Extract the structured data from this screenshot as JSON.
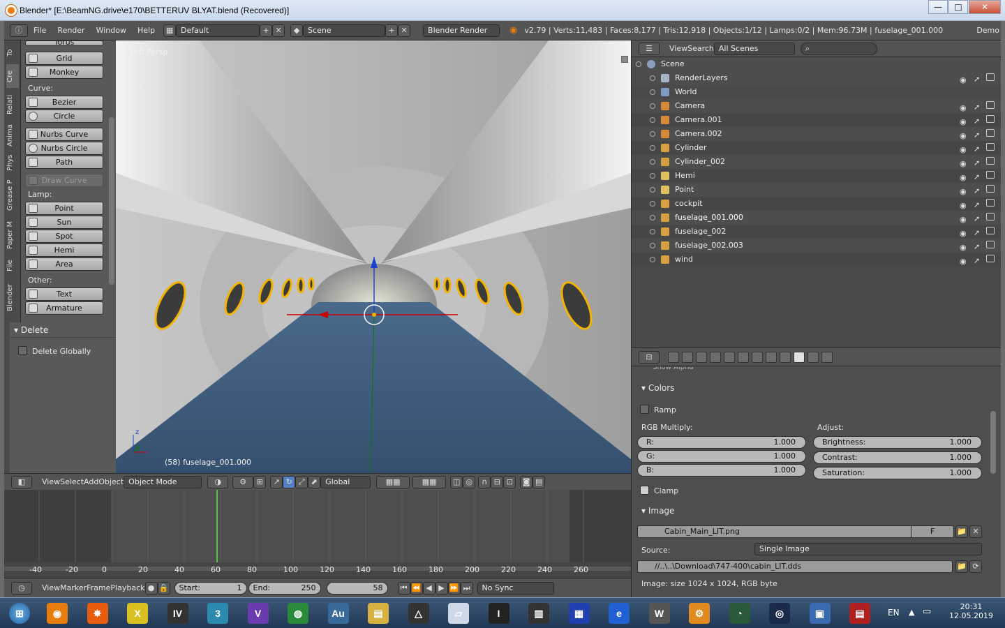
{
  "window": {
    "title": "Blender* [E:\\BeamNG.drive\\e170\\BETTERUV BLYAT.blend (Recovered)]",
    "btn_min": "—",
    "btn_max": "□",
    "btn_close": "✕"
  },
  "topbar": {
    "menus": [
      "File",
      "Render",
      "Window",
      "Help"
    ],
    "layout": "Default",
    "scene": "Scene",
    "engine": "Blender Render",
    "stats": "v2.79 | Verts:11,483 | Faces:8,177 | Tris:12,918 | Objects:1/12 | Lamps:0/2 | Mem:96.73M | fuselage_001.000",
    "demo": "Demo"
  },
  "lefttabs": [
    "To",
    "Cre",
    "Relati",
    "Anima",
    "Phys",
    "Grease P",
    "Paper M",
    "File",
    "Blender"
  ],
  "toolshelf": {
    "torus": "Torus",
    "grid": "Grid",
    "monkey": "Monkey",
    "curve_label": "Curve:",
    "bezier": "Bezier",
    "circle": "Circle",
    "nurbs_curve": "Nurbs Curve",
    "nurbs_circle": "Nurbs Circle",
    "path": "Path",
    "draw_curve": "Draw Curve",
    "lamp_label": "Lamp:",
    "point": "Point",
    "sun": "Sun",
    "spot": "Spot",
    "hemi": "Hemi",
    "area": "Area",
    "other_label": "Other:",
    "text": "Text",
    "armature": "Armature"
  },
  "delete_panel": {
    "title": "Delete",
    "option": "Delete Globally"
  },
  "viewport": {
    "label": "Left Persp",
    "object_info": "(58) fuselage_001.000",
    "axis_z": "z",
    "axis_y": "y"
  },
  "view_header": {
    "menus": [
      "View",
      "Select",
      "Add",
      "Object"
    ],
    "mode": "Object Mode",
    "orientation": "Global"
  },
  "timeline": {
    "ticks": [
      "-40",
      "-20",
      "0",
      "20",
      "40",
      "60",
      "80",
      "100",
      "120",
      "140",
      "160",
      "180",
      "200",
      "220",
      "240",
      "260"
    ],
    "current_frame": 58
  },
  "timeline_header": {
    "menus": [
      "View",
      "Marker",
      "Frame",
      "Playback"
    ],
    "start_label": "Start:",
    "start": "1",
    "end_label": "End:",
    "end": "250",
    "frame": "58",
    "sync": "No Sync"
  },
  "outliner": {
    "menus": [
      "View",
      "Search"
    ],
    "filter": "All Scenes",
    "root": "Scene",
    "items": [
      {
        "name": "RenderLayers",
        "icon": "renderlayers"
      },
      {
        "name": "World",
        "icon": "world"
      },
      {
        "name": "Camera",
        "icon": "camera"
      },
      {
        "name": "Camera.001",
        "icon": "camera"
      },
      {
        "name": "Camera.002",
        "icon": "camera"
      },
      {
        "name": "Cylinder",
        "icon": "mesh"
      },
      {
        "name": "Cylinder_002",
        "icon": "mesh"
      },
      {
        "name": "Hemi",
        "icon": "lamp"
      },
      {
        "name": "Point",
        "icon": "lamp"
      },
      {
        "name": "cockpit",
        "icon": "mesh"
      },
      {
        "name": "fuselage_001.000",
        "icon": "mesh"
      },
      {
        "name": "fuselage_002",
        "icon": "mesh"
      },
      {
        "name": "fuselage_002.003",
        "icon": "mesh"
      },
      {
        "name": "wind",
        "icon": "mesh"
      }
    ]
  },
  "props": {
    "show_alpha": "Show Alpha",
    "colors_title": "Colors",
    "ramp": "Ramp",
    "rgb_label": "RGB Multiply:",
    "adjust_label": "Adjust:",
    "r_label": "R:",
    "r": "1.000",
    "g_label": "G:",
    "g": "1.000",
    "b_label": "B:",
    "b": "1.000",
    "brightness_label": "Brightness:",
    "brightness": "1.000",
    "contrast_label": "Contrast:",
    "contrast": "1.000",
    "saturation_label": "Saturation:",
    "saturation": "1.000",
    "clamp": "Clamp",
    "image_title": "Image",
    "image_name": "Cabin_Main_LIT.png",
    "fake": "F",
    "source_label": "Source:",
    "source": "Single Image",
    "filepath": "//..\\..\\Download\\747-400\\cabin_LIT.dds",
    "image_info": "Image: size 1024 x 1024, RGB byte"
  },
  "taskbar": {
    "lang": "EN",
    "time": "20:31",
    "date": "12.05.2019",
    "icons": [
      "blender",
      "cluster",
      "x",
      "iv",
      "3ds max",
      "vs",
      "globe",
      "audition",
      "explorer",
      "triangle",
      "folder",
      "intellij",
      "piano",
      "audio",
      "ie",
      "w",
      "gear",
      "monitor",
      "steam",
      "control panel",
      "winrar"
    ]
  }
}
